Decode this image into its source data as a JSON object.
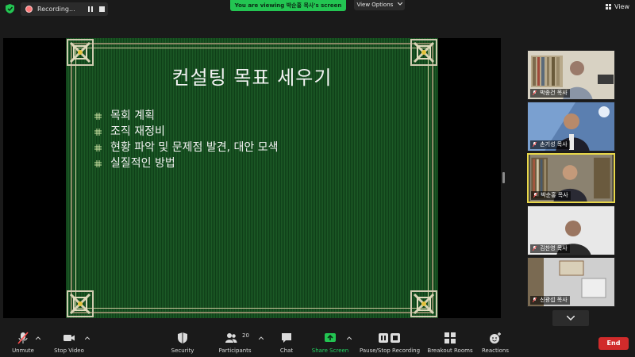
{
  "topbar": {
    "recording_label": "Recording...",
    "viewing_banner": "You are viewing 박순홍 목사's screen",
    "view_options_label": "View Options",
    "view_label": "View"
  },
  "slide": {
    "title": "컨설팅 목표 세우기",
    "bullets": [
      "목회 계획",
      "조직 재정비",
      "현황 파악 및 문제점 발견, 대안 모색",
      "실질적인 방법"
    ]
  },
  "participants": [
    {
      "name": "박종건 목사"
    },
    {
      "name": "손기성 목사"
    },
    {
      "name": "박순홍 목사"
    },
    {
      "name": "김찬영 목사"
    },
    {
      "name": "신광섭 목사"
    }
  ],
  "toolbar": {
    "unmute": "Unmute",
    "stop_video": "Stop Video",
    "security": "Security",
    "participants": "Participants",
    "participants_count": "20",
    "chat": "Chat",
    "share_screen": "Share Screen",
    "pause_stop_recording": "Pause/Stop Recording",
    "breakout_rooms": "Breakout Rooms",
    "reactions": "Reactions",
    "end": "End"
  },
  "colors": {
    "accent_green": "#23c552",
    "end_red": "#d12b2b",
    "active_speaker": "#e8d74a",
    "slide_green": "#1c5a26"
  }
}
